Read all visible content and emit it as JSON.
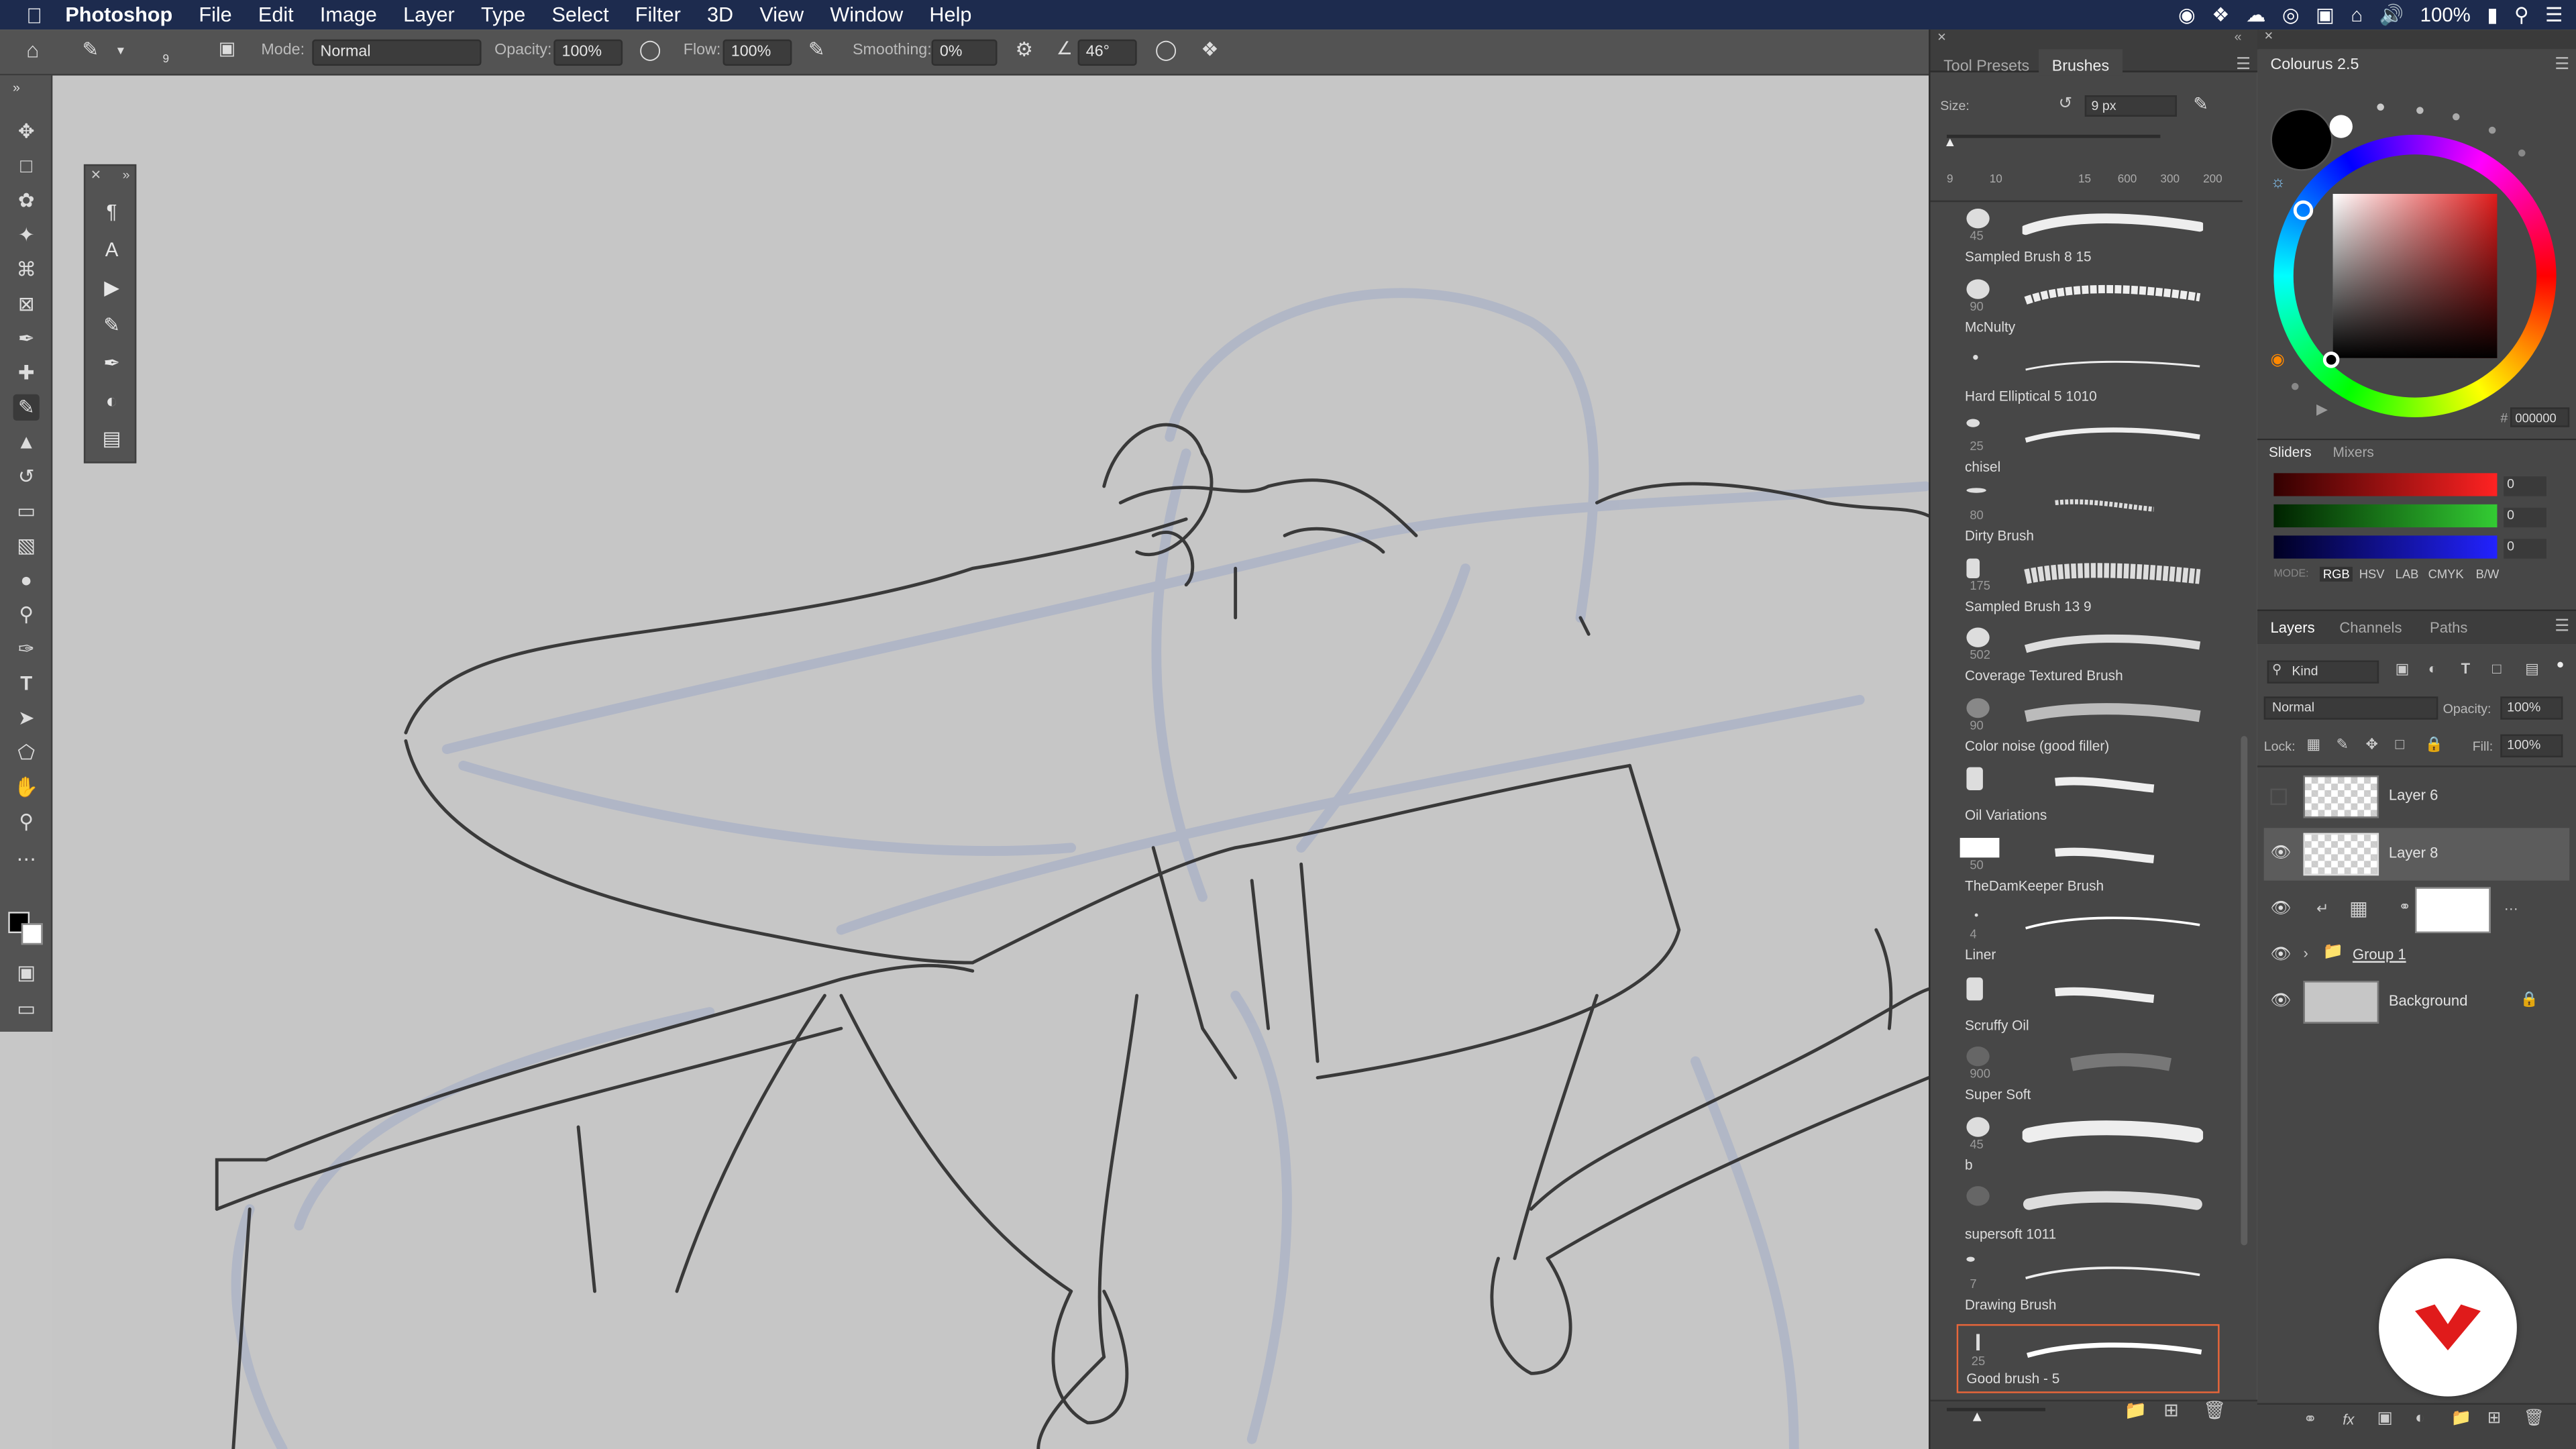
{
  "menubar": {
    "app": "Photoshop",
    "items": [
      "File",
      "Edit",
      "Image",
      "Layer",
      "Type",
      "Select",
      "Filter",
      "3D",
      "View",
      "Window",
      "Help"
    ],
    "battery": "100%"
  },
  "options": {
    "brush_size": "9",
    "mode_label": "Mode:",
    "mode_value": "Normal",
    "opacity_label": "Opacity:",
    "opacity_value": "100%",
    "flow_label": "Flow:",
    "flow_value": "100%",
    "smoothing_label": "Smoothing:",
    "smoothing_value": "0%",
    "angle_value": "46°"
  },
  "brushes_panel": {
    "tab_presets": "Tool Presets",
    "tab_brushes": "Brushes",
    "size_label": "Size:",
    "size_value": "9 px",
    "preset_sizes": [
      "9",
      "10",
      "",
      "15",
      "600",
      "300",
      "200"
    ],
    "items": [
      {
        "name": "Sampled Brush 8 15",
        "num": "45"
      },
      {
        "name": "McNulty",
        "num": "90"
      },
      {
        "name": "Hard Elliptical 5 1010",
        "num": ""
      },
      {
        "name": "chisel",
        "num": "25"
      },
      {
        "name": "Dirty Brush",
        "num": "80"
      },
      {
        "name": "Sampled Brush 13 9",
        "num": "175"
      },
      {
        "name": "Coverage Textured Brush",
        "num": "502"
      },
      {
        "name": "Color noise (good filler)",
        "num": "90"
      },
      {
        "name": "Oil Variations",
        "num": ""
      },
      {
        "name": "TheDamKeeper Brush",
        "num": "50"
      },
      {
        "name": "Liner",
        "num": "4"
      },
      {
        "name": "Scruffy Oil",
        "num": ""
      },
      {
        "name": "Super Soft",
        "num": "900"
      },
      {
        "name": "b",
        "num": "45"
      },
      {
        "name": "supersoft 1011",
        "num": ""
      },
      {
        "name": "Drawing Brush",
        "num": "7"
      },
      {
        "name": "Good brush - 5",
        "num": "25"
      }
    ],
    "selected_index": 16
  },
  "colour_panel": {
    "title": "Colourus 2.5",
    "hex": "000000",
    "hex_prefix": "#"
  },
  "sliders_panel": {
    "tab_sliders": "Sliders",
    "tab_mixers": "Mixers",
    "r": "0",
    "g": "0",
    "b": "0",
    "mode_label": "MODE:",
    "modes": [
      "RGB",
      "HSV",
      "LAB",
      "CMYK",
      "B/W"
    ]
  },
  "layers_panel": {
    "tab_layers": "Layers",
    "tab_channels": "Channels",
    "tab_paths": "Paths",
    "kind": "Kind",
    "blend": "Normal",
    "opacity_label": "Opacity:",
    "opacity_value": "100%",
    "lock_label": "Lock:",
    "fill_label": "Fill:",
    "fill_value": "100%",
    "layers": [
      {
        "name": "Layer 6",
        "visible": false
      },
      {
        "name": "Layer 8",
        "visible": true,
        "selected": true
      },
      {
        "name": "",
        "visible": true,
        "adjustment": true
      },
      {
        "name": "Group 1",
        "visible": true,
        "group": true
      },
      {
        "name": "Background",
        "visible": true,
        "locked": true
      }
    ]
  },
  "colors": {
    "accent_orange": "#e8663a",
    "brand_red": "#e01b1b",
    "menubar": "#1d2b4e"
  }
}
